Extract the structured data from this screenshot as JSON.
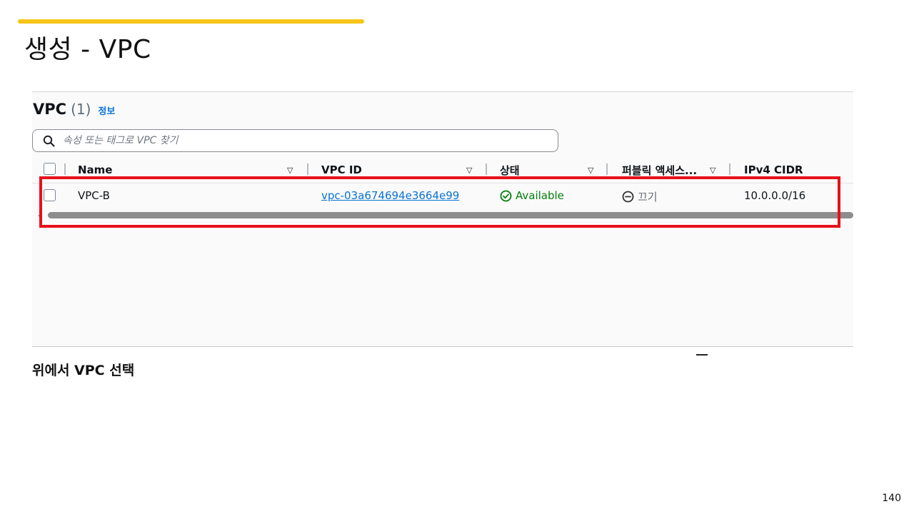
{
  "slide": {
    "title": "생성 - VPC",
    "caption": "위에서 VPC 선택",
    "page_number": "140",
    "accent_color": "#f5c518",
    "highlight_color": "#e8101a"
  },
  "panel": {
    "title": "VPC",
    "count": "(1)",
    "info_link": "정보",
    "search_placeholder": "속성 또는 태그로 VPC 찾기",
    "columns": [
      {
        "label": "Name"
      },
      {
        "label": "VPC ID"
      },
      {
        "label": "상태"
      },
      {
        "label": "퍼블릭 액세스..."
      },
      {
        "label": "IPv4 CIDR"
      }
    ],
    "rows": [
      {
        "name": "VPC-B",
        "vpc_id": "vpc-03a674694e3664e99",
        "status": "Available",
        "public_access": "끄기",
        "ipv4_cidr": "10.0.0.0/16"
      }
    ],
    "icons": {
      "search": "search-icon",
      "sort": "sort-down-icon",
      "status_ok": "check-circle-icon",
      "status_off": "minus-circle-icon"
    },
    "colors": {
      "link": "#0972d3",
      "status_ok": "#037f0c",
      "muted": "#5f6b7a"
    }
  }
}
